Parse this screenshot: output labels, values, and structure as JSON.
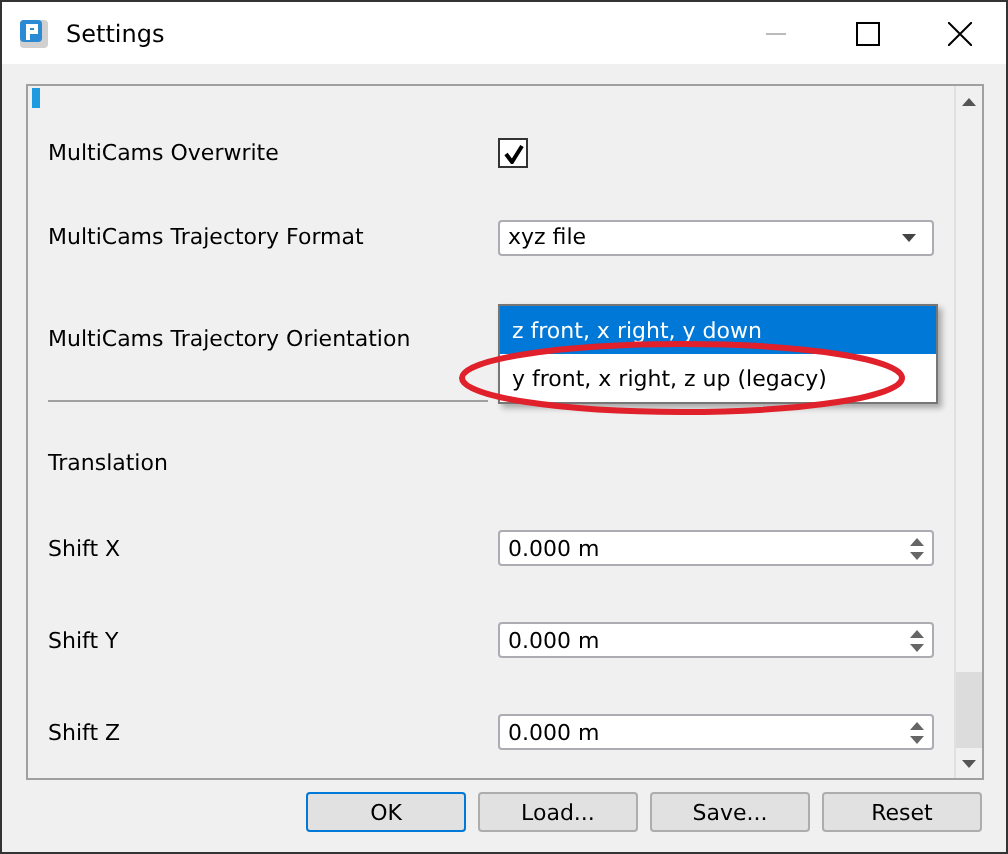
{
  "window": {
    "title": "Settings"
  },
  "rows": [
    {
      "kind": "checkbox",
      "label": "MultiCams Overwrite",
      "checked": true
    },
    {
      "kind": "combo",
      "label": "MultiCams Trajectory Format",
      "value": "xyz file"
    },
    {
      "kind": "open_combo",
      "label": "MultiCams Trajectory Orientation",
      "options": [
        {
          "label": "z front, x right, y down",
          "selected": true
        },
        {
          "label": "y front, x right, z up (legacy)",
          "selected": false
        }
      ]
    },
    {
      "kind": "divider"
    },
    {
      "kind": "section",
      "label": "Translation"
    },
    {
      "kind": "spin",
      "label": "Shift X",
      "value": "0.000 m"
    },
    {
      "kind": "spin",
      "label": "Shift Y",
      "value": "0.000 m"
    },
    {
      "kind": "spin",
      "label": "Shift Z",
      "value": "0.000 m"
    }
  ],
  "buttons": [
    {
      "label": "OK",
      "default": true
    },
    {
      "label": "Load...",
      "default": false
    },
    {
      "label": "Save...",
      "default": false
    },
    {
      "label": "Reset",
      "default": false
    }
  ]
}
